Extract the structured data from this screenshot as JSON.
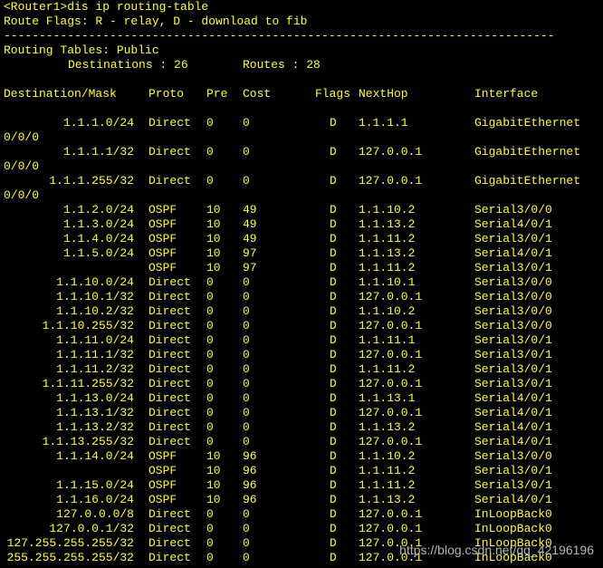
{
  "prompt_command": "<Router1>dis ip routing-table",
  "route_flags": "Route Flags: R - relay, D - download to fib",
  "separator": "------------------------------------------------------------------------------",
  "tables_title": "Routing Tables: Public",
  "summary": {
    "destinations_label": "Destinations : 26",
    "routes_label": "Routes : 28"
  },
  "headers": {
    "destination": "Destination/Mask",
    "proto": "Proto",
    "pre": "Pre",
    "cost": "Cost",
    "flags": "Flags",
    "nexthop": "NextHop",
    "interface": "Interface"
  },
  "rows": [
    {
      "dest": "1.1.1.0/24",
      "proto": "Direct",
      "pre": "0",
      "cost": "0",
      "flags": "D",
      "nexthop": "1.1.1.1",
      "iface": "GigabitEthernet",
      "wrap": "0/0/0"
    },
    {
      "dest": "1.1.1.1/32",
      "proto": "Direct",
      "pre": "0",
      "cost": "0",
      "flags": "D",
      "nexthop": "127.0.0.1",
      "iface": "GigabitEthernet",
      "wrap": "0/0/0"
    },
    {
      "dest": "1.1.1.255/32",
      "proto": "Direct",
      "pre": "0",
      "cost": "0",
      "flags": "D",
      "nexthop": "127.0.0.1",
      "iface": "GigabitEthernet",
      "wrap": "0/0/0"
    },
    {
      "dest": "1.1.2.0/24",
      "proto": "OSPF",
      "pre": "10",
      "cost": "49",
      "flags": "D",
      "nexthop": "1.1.10.2",
      "iface": "Serial3/0/0",
      "wrap": ""
    },
    {
      "dest": "1.1.3.0/24",
      "proto": "OSPF",
      "pre": "10",
      "cost": "49",
      "flags": "D",
      "nexthop": "1.1.13.2",
      "iface": "Serial4/0/1",
      "wrap": ""
    },
    {
      "dest": "1.1.4.0/24",
      "proto": "OSPF",
      "pre": "10",
      "cost": "49",
      "flags": "D",
      "nexthop": "1.1.11.2",
      "iface": "Serial3/0/1",
      "wrap": ""
    },
    {
      "dest": "1.1.5.0/24",
      "proto": "OSPF",
      "pre": "10",
      "cost": "97",
      "flags": "D",
      "nexthop": "1.1.13.2",
      "iface": "Serial4/0/1",
      "wrap": ""
    },
    {
      "dest": "",
      "proto": "OSPF",
      "pre": "10",
      "cost": "97",
      "flags": "D",
      "nexthop": "1.1.11.2",
      "iface": "Serial3/0/1",
      "wrap": ""
    },
    {
      "dest": "1.1.10.0/24",
      "proto": "Direct",
      "pre": "0",
      "cost": "0",
      "flags": "D",
      "nexthop": "1.1.10.1",
      "iface": "Serial3/0/0",
      "wrap": ""
    },
    {
      "dest": "1.1.10.1/32",
      "proto": "Direct",
      "pre": "0",
      "cost": "0",
      "flags": "D",
      "nexthop": "127.0.0.1",
      "iface": "Serial3/0/0",
      "wrap": ""
    },
    {
      "dest": "1.1.10.2/32",
      "proto": "Direct",
      "pre": "0",
      "cost": "0",
      "flags": "D",
      "nexthop": "1.1.10.2",
      "iface": "Serial3/0/0",
      "wrap": ""
    },
    {
      "dest": "1.1.10.255/32",
      "proto": "Direct",
      "pre": "0",
      "cost": "0",
      "flags": "D",
      "nexthop": "127.0.0.1",
      "iface": "Serial3/0/0",
      "wrap": ""
    },
    {
      "dest": "1.1.11.0/24",
      "proto": "Direct",
      "pre": "0",
      "cost": "0",
      "flags": "D",
      "nexthop": "1.1.11.1",
      "iface": "Serial3/0/1",
      "wrap": ""
    },
    {
      "dest": "1.1.11.1/32",
      "proto": "Direct",
      "pre": "0",
      "cost": "0",
      "flags": "D",
      "nexthop": "127.0.0.1",
      "iface": "Serial3/0/1",
      "wrap": ""
    },
    {
      "dest": "1.1.11.2/32",
      "proto": "Direct",
      "pre": "0",
      "cost": "0",
      "flags": "D",
      "nexthop": "1.1.11.2",
      "iface": "Serial3/0/1",
      "wrap": ""
    },
    {
      "dest": "1.1.11.255/32",
      "proto": "Direct",
      "pre": "0",
      "cost": "0",
      "flags": "D",
      "nexthop": "127.0.0.1",
      "iface": "Serial3/0/1",
      "wrap": ""
    },
    {
      "dest": "1.1.13.0/24",
      "proto": "Direct",
      "pre": "0",
      "cost": "0",
      "flags": "D",
      "nexthop": "1.1.13.1",
      "iface": "Serial4/0/1",
      "wrap": ""
    },
    {
      "dest": "1.1.13.1/32",
      "proto": "Direct",
      "pre": "0",
      "cost": "0",
      "flags": "D",
      "nexthop": "127.0.0.1",
      "iface": "Serial4/0/1",
      "wrap": ""
    },
    {
      "dest": "1.1.13.2/32",
      "proto": "Direct",
      "pre": "0",
      "cost": "0",
      "flags": "D",
      "nexthop": "1.1.13.2",
      "iface": "Serial4/0/1",
      "wrap": ""
    },
    {
      "dest": "1.1.13.255/32",
      "proto": "Direct",
      "pre": "0",
      "cost": "0",
      "flags": "D",
      "nexthop": "127.0.0.1",
      "iface": "Serial4/0/1",
      "wrap": ""
    },
    {
      "dest": "1.1.14.0/24",
      "proto": "OSPF",
      "pre": "10",
      "cost": "96",
      "flags": "D",
      "nexthop": "1.1.10.2",
      "iface": "Serial3/0/0",
      "wrap": ""
    },
    {
      "dest": "",
      "proto": "OSPF",
      "pre": "10",
      "cost": "96",
      "flags": "D",
      "nexthop": "1.1.11.2",
      "iface": "Serial3/0/1",
      "wrap": ""
    },
    {
      "dest": "1.1.15.0/24",
      "proto": "OSPF",
      "pre": "10",
      "cost": "96",
      "flags": "D",
      "nexthop": "1.1.11.2",
      "iface": "Serial3/0/1",
      "wrap": ""
    },
    {
      "dest": "1.1.16.0/24",
      "proto": "OSPF",
      "pre": "10",
      "cost": "96",
      "flags": "D",
      "nexthop": "1.1.13.2",
      "iface": "Serial4/0/1",
      "wrap": ""
    },
    {
      "dest": "127.0.0.0/8",
      "proto": "Direct",
      "pre": "0",
      "cost": "0",
      "flags": "D",
      "nexthop": "127.0.0.1",
      "iface": "InLoopBack0",
      "wrap": ""
    },
    {
      "dest": "127.0.0.1/32",
      "proto": "Direct",
      "pre": "0",
      "cost": "0",
      "flags": "D",
      "nexthop": "127.0.0.1",
      "iface": "InLoopBack0",
      "wrap": ""
    },
    {
      "dest": "127.255.255.255/32",
      "proto": "Direct",
      "pre": "0",
      "cost": "0",
      "flags": "D",
      "nexthop": "127.0.0.1",
      "iface": "InLoopBack0",
      "wrap": ""
    },
    {
      "dest": "255.255.255.255/32",
      "proto": "Direct",
      "pre": "0",
      "cost": "0",
      "flags": "D",
      "nexthop": "127.0.0.1",
      "iface": "InLoopBack0",
      "wrap": ""
    }
  ],
  "watermark": "https://blog.csdn.net/qq_42196196",
  "colors": {
    "background": "#000000",
    "text": "#ffff33",
    "watermark": "#c8c8c8"
  }
}
